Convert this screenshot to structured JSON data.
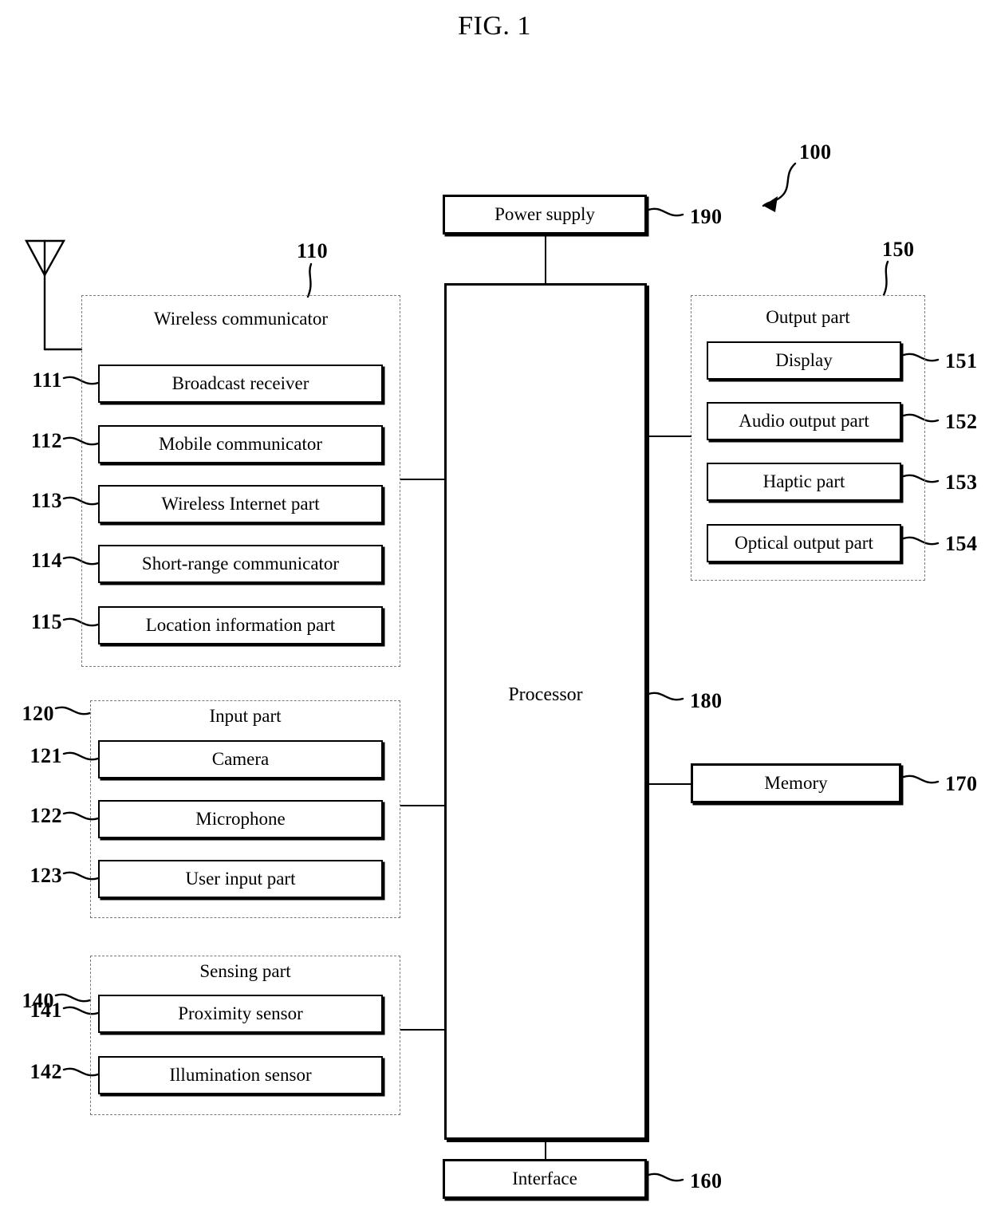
{
  "figure": {
    "title": "FIG. 1",
    "system_ref": "100"
  },
  "blocks": {
    "power_supply": {
      "label": "Power supply",
      "ref": "190"
    },
    "processor": {
      "label": "Processor",
      "ref": "180"
    },
    "memory": {
      "label": "Memory",
      "ref": "170"
    },
    "interface": {
      "label": "Interface",
      "ref": "160"
    }
  },
  "groups": {
    "wireless": {
      "title": "Wireless communicator",
      "ref": "110",
      "items": [
        {
          "ref": "111",
          "label": "Broadcast receiver"
        },
        {
          "ref": "112",
          "label": "Mobile communicator"
        },
        {
          "ref": "113",
          "label": "Wireless Internet part"
        },
        {
          "ref": "114",
          "label": "Short-range communicator"
        },
        {
          "ref": "115",
          "label": "Location information part"
        }
      ]
    },
    "input": {
      "title": "Input part",
      "ref": "120",
      "items": [
        {
          "ref": "121",
          "label": "Camera"
        },
        {
          "ref": "122",
          "label": "Microphone"
        },
        {
          "ref": "123",
          "label": "User input part"
        }
      ]
    },
    "sensing": {
      "title": "Sensing part",
      "ref": "140",
      "items": [
        {
          "ref": "141",
          "label": "Proximity sensor"
        },
        {
          "ref": "142",
          "label": "Illumination sensor"
        }
      ]
    },
    "output": {
      "title": "Output part",
      "ref": "150",
      "items": [
        {
          "ref": "151",
          "label": "Display"
        },
        {
          "ref": "152",
          "label": "Audio output part"
        },
        {
          "ref": "153",
          "label": "Haptic part"
        },
        {
          "ref": "154",
          "label": "Optical output part"
        }
      ]
    }
  },
  "icons": {
    "antenna": "antenna-icon"
  },
  "colors": {
    "ink": "#000000",
    "dashed": "#7a7a7a",
    "background": "#ffffff"
  }
}
